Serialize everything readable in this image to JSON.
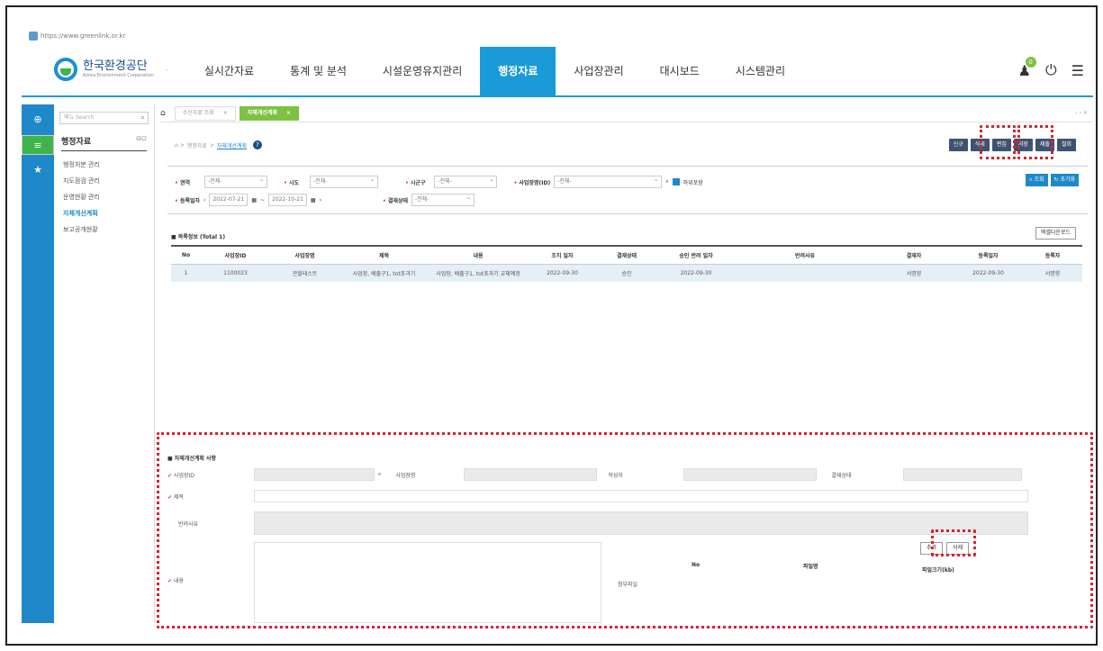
{
  "browser": {
    "url": "https://www.greenlink.or.kr"
  },
  "header": {
    "logo_name": "한국환경공단",
    "logo_sub": "Korea Environment Corporation",
    "menu": [
      "실시간자료",
      "통계 및 분석",
      "시설운영유지관리",
      "행정자료",
      "사업장관리",
      "대시보드",
      "시스템관리"
    ],
    "active_menu": "행정자료",
    "notification_count": "0"
  },
  "sidebar": {
    "search_placeholder": "메뉴 Search",
    "title": "행정자료",
    "items": [
      "행정처분 관리",
      "지도점검 관리",
      "운영현황 관리",
      "자체개선계획",
      "보고공개현황"
    ],
    "selected": "자체개선계획"
  },
  "tabs": {
    "first": "수신자료 조회",
    "active": "자체개선계획"
  },
  "breadcrumb": {
    "parent": "행정자료",
    "current": "자체개선계획"
  },
  "toolbar": [
    "신규",
    "삭제",
    "편집",
    "저장",
    "제출",
    "철회"
  ],
  "search": {
    "region_label": "권역",
    "region_value": "-전체-",
    "sido_label": "시도",
    "sido_value": "-전체-",
    "sigungu_label": "시군구",
    "sigungu_value": "-전체-",
    "site_label": "사업장명(ID)",
    "site_value": "-전체-",
    "subsite_label": "하위포함",
    "date_label": "등록일자",
    "date_from": "2022-07-21",
    "date_to": "2022-10-21",
    "status_label": "결재상태",
    "status_value": "-전체-",
    "search_btn": "조회",
    "reset_btn": "초기화"
  },
  "list": {
    "title": "목록정보 (Total 1)",
    "excel_btn": "엑셀다운로드",
    "columns": [
      "No",
      "사업장ID",
      "사업장명",
      "제목",
      "내용",
      "조치 일자",
      "결재상태",
      "승인 반려 일자",
      "반려사유",
      "결재자",
      "등록일자",
      "등록자"
    ],
    "rows": [
      [
        "1",
        "1100023",
        "관할테스트",
        "사업장, 배출구1, tot초과기",
        "사업장, 배출구1, tot초과기 교체예정",
        "2022-09-30",
        "승인",
        "2022-09-30",
        "",
        "서명향",
        "2022-09-30",
        "서명향"
      ]
    ]
  },
  "detail": {
    "title": "자체개선계획 사항",
    "site_id_label": "사업장ID",
    "site_name_label": "사업장명",
    "writer_label": "작성자",
    "status_label": "결재상태",
    "subject_label": "제목",
    "reject_label": "반려사유",
    "content_label": "내용",
    "attach_label": "첨부파일",
    "add_btn": "추가",
    "delete_btn": "삭제",
    "file_cols": [
      "No",
      "파일명",
      "파일크기(kb)"
    ]
  }
}
